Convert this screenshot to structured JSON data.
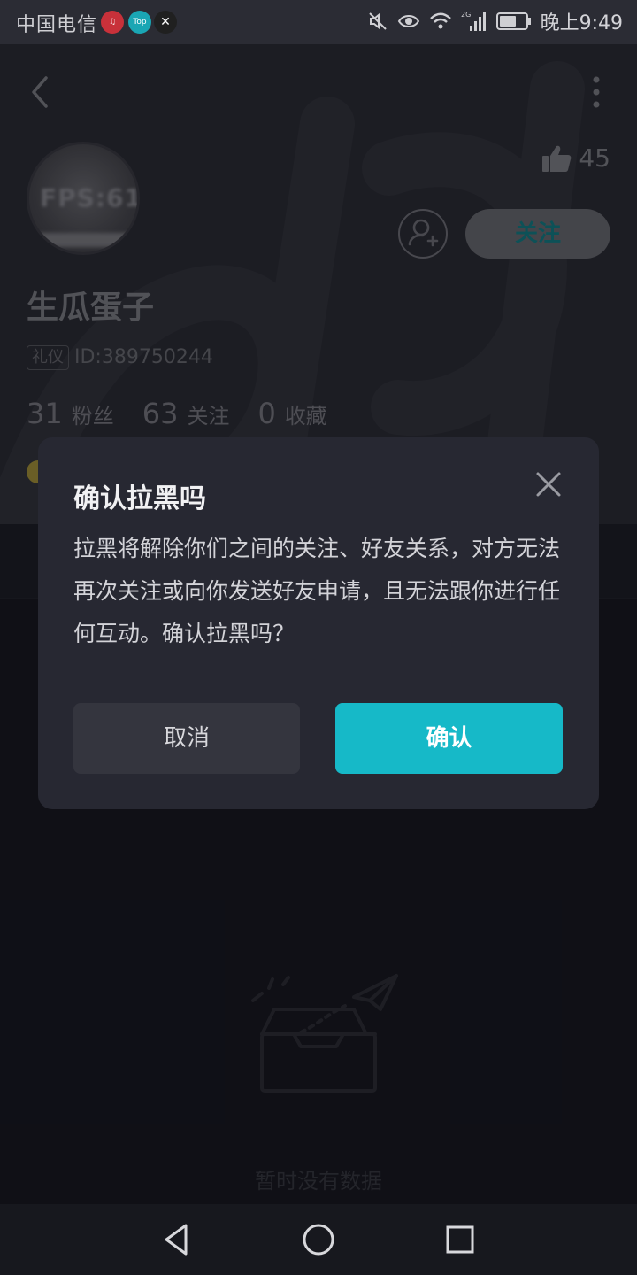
{
  "status_bar": {
    "carrier": "中国电信",
    "network_badge": "2G",
    "time": "晚上9:49",
    "icons": [
      "app-notification-icon",
      "top-app-icon",
      "capcut-icon",
      "mute-icon",
      "eye-care-icon",
      "wifi-icon",
      "signal-icon",
      "battery-icon"
    ]
  },
  "header": {
    "back_icon": "chevron-left-icon",
    "more_icon": "more-vertical-icon"
  },
  "profile": {
    "avatar_text": "FPS:61.",
    "likes": "45",
    "username": "生瓜蛋子",
    "badge": "礼仪",
    "id_label": "ID:389750244",
    "follow_label": "关注",
    "stats": [
      {
        "value": "31",
        "label": "粉丝"
      },
      {
        "value": "63",
        "label": "关注"
      },
      {
        "value": "0",
        "label": "收藏"
      }
    ]
  },
  "empty_state": {
    "text": "暂时没有数据"
  },
  "dialog": {
    "title": "确认拉黑吗",
    "message": "拉黑将解除你们之间的关注、好友关系，对方无法再次关注或向你发送好友申请，且无法跟你进行任何互动。确认拉黑吗？",
    "cancel_label": "取消",
    "confirm_label": "确认"
  },
  "colors": {
    "accent": "#16b9c8",
    "dialog_bg": "#272832",
    "page_bg": "#101118"
  }
}
